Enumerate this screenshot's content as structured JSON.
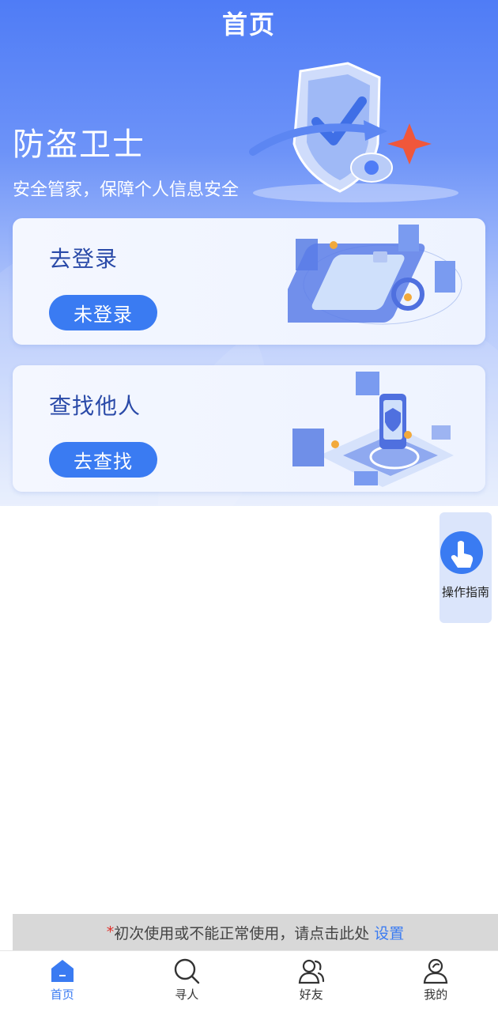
{
  "header": {
    "title": "首页"
  },
  "hero": {
    "title": "防盗卫士",
    "subtitle": "安全管家，保障个人信息安全"
  },
  "cards": [
    {
      "title": "去登录",
      "button": "未登录",
      "illustration": "phone-security-illustration"
    },
    {
      "title": "查找他人",
      "button": "去查找",
      "illustration": "location-search-illustration"
    }
  ],
  "guide": {
    "label": "操作指南",
    "icon": "hand-tap-icon"
  },
  "notice": {
    "star": "*",
    "text": "初次使用或不能正常使用，请点击此处",
    "link": "设置"
  },
  "tabbar": {
    "items": [
      {
        "label": "首页",
        "icon": "home-icon",
        "active": true
      },
      {
        "label": "寻人",
        "icon": "search-icon",
        "active": false
      },
      {
        "label": "好友",
        "icon": "friends-icon",
        "active": false
      },
      {
        "label": "我的",
        "icon": "user-icon",
        "active": false
      }
    ]
  },
  "colors": {
    "primary": "#3a7bf2",
    "header_top": "#4f7cf6",
    "notice_star": "#e0322c"
  }
}
